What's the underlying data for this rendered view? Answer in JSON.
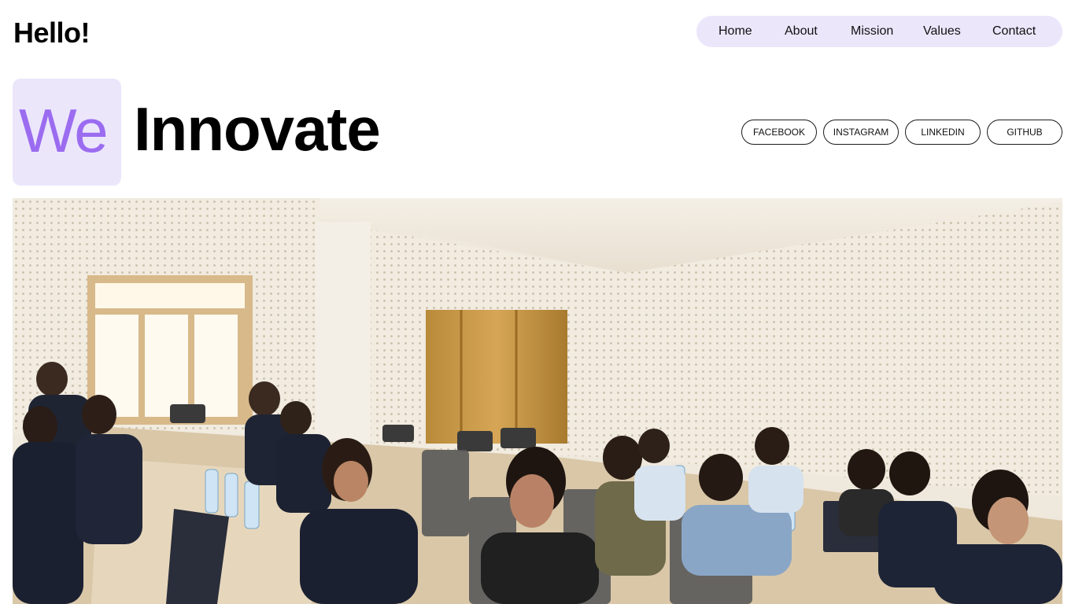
{
  "header": {
    "brand": "Hello!",
    "nav": [
      {
        "label": "Home"
      },
      {
        "label": "About"
      },
      {
        "label": "Mission"
      },
      {
        "label": "Values"
      },
      {
        "label": "Contact"
      }
    ]
  },
  "hero": {
    "highlight": "We",
    "headline": "Innovate",
    "socials": [
      {
        "label": "FACEBOOK"
      },
      {
        "label": "INSTAGRAM"
      },
      {
        "label": "LINKEDIN"
      },
      {
        "label": "GITHUB"
      }
    ]
  },
  "colors": {
    "accent": "#9b6cf0",
    "accent_bg": "#ece6fb",
    "text": "#000000",
    "background": "#ffffff"
  },
  "photo": {
    "icon": "group-photo"
  }
}
